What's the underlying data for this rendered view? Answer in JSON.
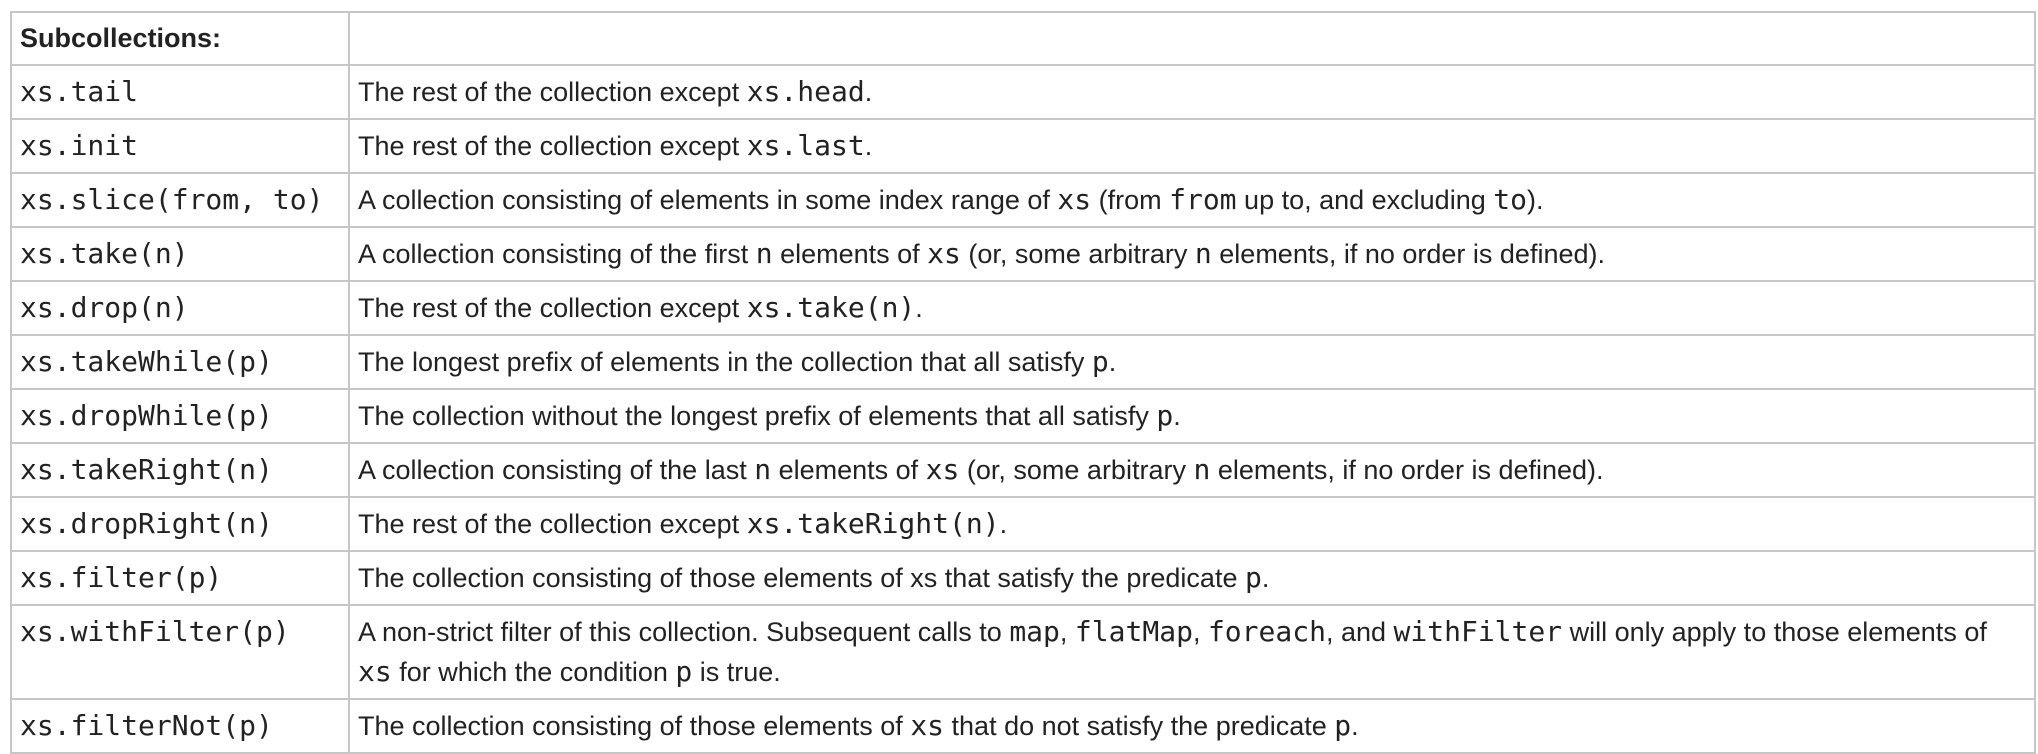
{
  "table": {
    "header": {
      "label": "Subcollections:",
      "empty": ""
    },
    "rows": [
      {
        "op": "xs.tail",
        "desc": [
          {
            "t": "The rest of the collection except "
          },
          {
            "c": "xs.head"
          },
          {
            "t": "."
          }
        ]
      },
      {
        "op": "xs.init",
        "desc": [
          {
            "t": "The rest of the collection except "
          },
          {
            "c": "xs.last"
          },
          {
            "t": "."
          }
        ]
      },
      {
        "op": "xs.slice(from, to)",
        "desc": [
          {
            "t": "A collection consisting of elements in some index range of "
          },
          {
            "c": "xs"
          },
          {
            "t": " (from "
          },
          {
            "c": "from"
          },
          {
            "t": " up to, and excluding "
          },
          {
            "c": "to"
          },
          {
            "t": ")."
          }
        ]
      },
      {
        "op": "xs.take(n)",
        "desc": [
          {
            "t": "A collection consisting of the first "
          },
          {
            "c": "n"
          },
          {
            "t": " elements of "
          },
          {
            "c": "xs"
          },
          {
            "t": " (or, some arbitrary "
          },
          {
            "c": "n"
          },
          {
            "t": " elements, if no order is defined)."
          }
        ]
      },
      {
        "op": "xs.drop(n)",
        "desc": [
          {
            "t": "The rest of the collection except "
          },
          {
            "c": "xs.take(n)"
          },
          {
            "t": "."
          }
        ]
      },
      {
        "op": "xs.takeWhile(p)",
        "desc": [
          {
            "t": "The longest prefix of elements in the collection that all satisfy "
          },
          {
            "c": "p"
          },
          {
            "t": "."
          }
        ]
      },
      {
        "op": "xs.dropWhile(p)",
        "desc": [
          {
            "t": "The collection without the longest prefix of elements that all satisfy "
          },
          {
            "c": "p"
          },
          {
            "t": "."
          }
        ]
      },
      {
        "op": "xs.takeRight(n)",
        "desc": [
          {
            "t": "A collection consisting of the last "
          },
          {
            "c": "n"
          },
          {
            "t": " elements of "
          },
          {
            "c": "xs"
          },
          {
            "t": " (or, some arbitrary "
          },
          {
            "c": "n"
          },
          {
            "t": " elements, if no order is defined)."
          }
        ]
      },
      {
        "op": "xs.dropRight(n)",
        "desc": [
          {
            "t": "The rest of the collection except "
          },
          {
            "c": "xs.takeRight(n)"
          },
          {
            "t": "."
          }
        ]
      },
      {
        "op": "xs.filter(p)",
        "desc": [
          {
            "t": "The collection consisting of those elements of xs that satisfy the predicate "
          },
          {
            "c": "p"
          },
          {
            "t": "."
          }
        ]
      },
      {
        "op": "xs.withFilter(p)",
        "desc": [
          {
            "t": "A non-strict filter of this collection. Subsequent calls to "
          },
          {
            "c": "map"
          },
          {
            "t": ", "
          },
          {
            "c": "flatMap"
          },
          {
            "t": ", "
          },
          {
            "c": "foreach"
          },
          {
            "t": ", and "
          },
          {
            "c": "withFilter"
          },
          {
            "t": " will only apply to those elements of "
          },
          {
            "c": "xs"
          },
          {
            "t": " for which the condition "
          },
          {
            "c": "p"
          },
          {
            "t": " is true."
          }
        ]
      },
      {
        "op": "xs.filterNot(p)",
        "desc": [
          {
            "t": "The collection consisting of those elements of "
          },
          {
            "c": "xs"
          },
          {
            "t": " that do not satisfy the predicate "
          },
          {
            "c": "p"
          },
          {
            "t": "."
          }
        ]
      }
    ]
  }
}
